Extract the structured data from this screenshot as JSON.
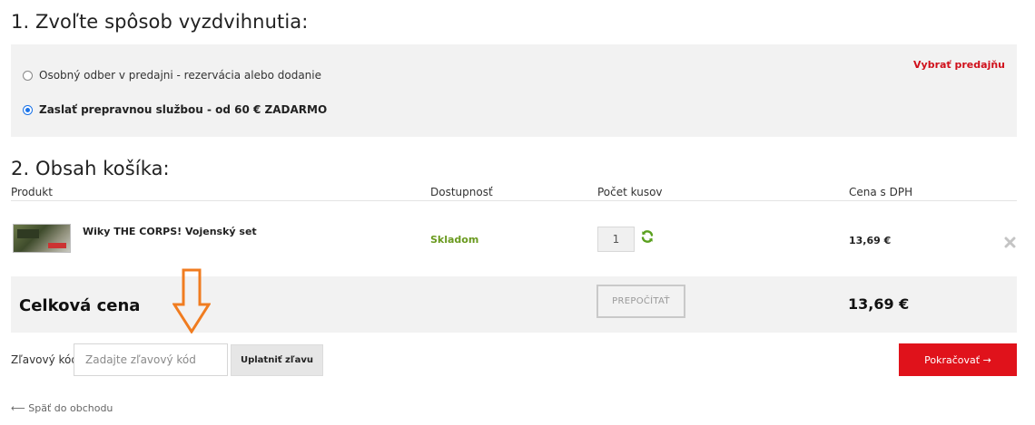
{
  "step1": {
    "title": "1. Zvoľte spôsob vyzdvihnutia:",
    "options": [
      {
        "label": "Osobný odber v predajni - rezervácia alebo dodanie",
        "selected": false
      },
      {
        "label": "Zaslať prepravnou službou - od 60 € ZADARMO",
        "selected": true
      }
    ],
    "select_store_label": "Vybrať predajňu"
  },
  "step2": {
    "title": "2. Obsah košíka:",
    "columns": [
      "Produkt",
      "Dostupnosť",
      "Počet kusov",
      "Cena s DPH"
    ],
    "items": [
      {
        "name": "Wiky THE CORPS! Vojenský set",
        "availability": "Skladom",
        "quantity": "1",
        "price": "13,69 €"
      }
    ],
    "total_label": "Celková cena",
    "recalc_label": "PREPOČÍTAŤ",
    "total_price": "13,69 €"
  },
  "coupon": {
    "label": "Zľavový kód:",
    "placeholder": "Zadajte zľavový kód",
    "apply_label": "Uplatniť zľavu"
  },
  "continue_label": "Pokračovať →",
  "back_label": "⟵ Späť do obchodu",
  "colors": {
    "accent_red": "#e0121b",
    "stock_green": "#6a9a1f",
    "arrow_orange": "#f07c20",
    "panel_bg": "#f2f2f2"
  }
}
